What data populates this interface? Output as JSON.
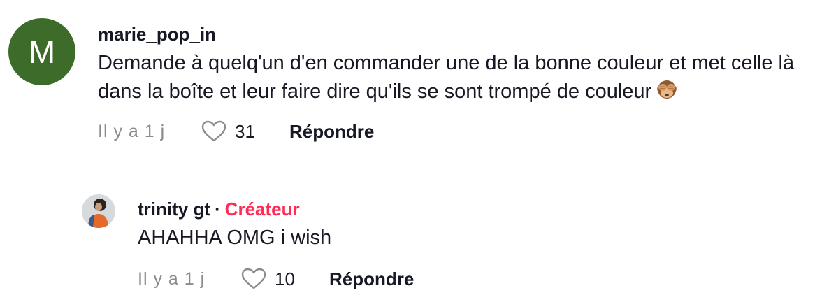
{
  "comments": [
    {
      "avatar_letter": "M",
      "avatar_color": "#3c6b2a",
      "username": "marie_pop_in",
      "text": "Demande à quelq'un d'en commander une de la bonne couleur et met celle là dans la boîte et leur faire dire qu'ils se sont trompé de couleur",
      "emoji": "see-no-evil-monkey-icon",
      "time": "Il y a 1 j",
      "likes": "31",
      "reply_label": "Répondre"
    }
  ],
  "reply": {
    "username": "trinity gt",
    "separator": "·",
    "badge": "Créateur",
    "badge_color": "#fe2c55",
    "text": "AHAHHA OMG i wish",
    "time": "Il y a 1 j",
    "likes": "10",
    "reply_label": "Répondre"
  }
}
